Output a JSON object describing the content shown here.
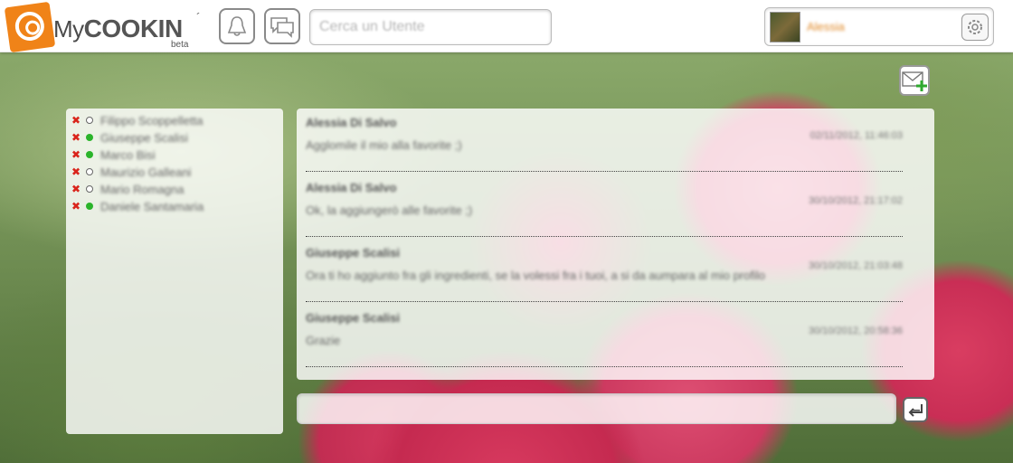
{
  "header": {
    "logo": {
      "prefix": "My",
      "name": "COOKIN",
      "accent": "´",
      "tag": "beta"
    },
    "notifications_icon": "bell-icon",
    "messages_icon": "speech-bubbles-icon",
    "search": {
      "placeholder": "Cerca un Utente",
      "value": ""
    },
    "user": {
      "name": "Alessia",
      "settings_icon": "gear-icon"
    }
  },
  "actions": {
    "new_message_icon": "envelope-plus-icon",
    "send_icon": "send-arrow-icon"
  },
  "contacts": [
    {
      "name": "Filippo Scoppelletta",
      "online": false
    },
    {
      "name": "Giuseppe Scalisi",
      "online": true
    },
    {
      "name": "Marco Bisi",
      "online": true
    },
    {
      "name": "Maurizio Galleani",
      "online": false
    },
    {
      "name": "Mario Romagna",
      "online": false
    },
    {
      "name": "Daniele Santamaria",
      "online": true
    }
  ],
  "messages": [
    {
      "author": "Alessia Di Salvo",
      "date": "02/11/2012, 11:46:03",
      "text": "Agglomile il mio alla favorite ;)"
    },
    {
      "author": "Alessia Di Salvo",
      "date": "30/10/2012, 21:17:02",
      "text": "Ok, la aggiungerò alle favorite ;)"
    },
    {
      "author": "Giuseppe Scalisi",
      "date": "30/10/2012, 21:03:48",
      "text": "Ora ti ho aggiunto fra gli ingredienti, se la volessi fra i tuoi, a si da aumpara al mio profilo"
    },
    {
      "author": "Giuseppe Scalisi",
      "date": "30/10/2012, 20:58:36",
      "text": "Grazie"
    }
  ],
  "reply": {
    "placeholder": "",
    "value": ""
  },
  "colors": {
    "brand_orange": "#f08318",
    "delete_red": "#d9241b",
    "online_green": "#2bb42b"
  }
}
